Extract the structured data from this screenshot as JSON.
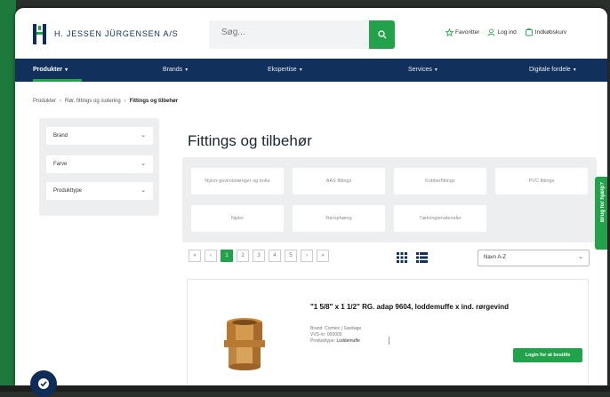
{
  "brand": {
    "name": "H. JESSEN JÜRGENSEN A/S"
  },
  "search": {
    "placeholder": "Søg..."
  },
  "top_links": [
    {
      "label": "Favoritter",
      "icon": "star-icon"
    },
    {
      "label": "Log ind",
      "icon": "user-icon"
    },
    {
      "label": "Indkøbskurv",
      "icon": "cart-icon"
    }
  ],
  "nav": [
    {
      "label": "Produkter"
    },
    {
      "label": "Brands"
    },
    {
      "label": "Ekspertise"
    },
    {
      "label": "Services"
    },
    {
      "label": "Digitale fordele"
    }
  ],
  "breadcrumb": {
    "home": "Produkter",
    "level2": "Rør, fittings og isolering",
    "current": "Fittings og tilbehør"
  },
  "filters": [
    "Brand",
    "Farve",
    "Produkttype"
  ],
  "page_title": "Fittings og tilbehør",
  "categories": [
    "Nylon-gevindstænger og bolte",
    "AAS fittings",
    "Kobberfittings",
    "PVC fittings",
    "Nipler",
    "Rørophæng",
    "Tætningsmaterialer"
  ],
  "pager": [
    "«",
    "‹",
    "1",
    "2",
    "3",
    "4",
    "5",
    "›",
    "»"
  ],
  "sort": {
    "value": "Navn A-Z"
  },
  "product": {
    "title": "\"1 5/8\" x 1 1/2\" RG. adap 9604, loddemuffe x ind. rørgevind",
    "meta_brand": "Brand: Comtec | Sanitage",
    "meta_sku": "VVS-nr: 000000",
    "meta_type_label": "Produkttype:",
    "meta_type_value": "Loddemuffe",
    "button": "Login for at bestille"
  },
  "side_tab": "Brug for hjælp?",
  "colors": {
    "green": "#22a24a",
    "navy": "#12305c"
  }
}
